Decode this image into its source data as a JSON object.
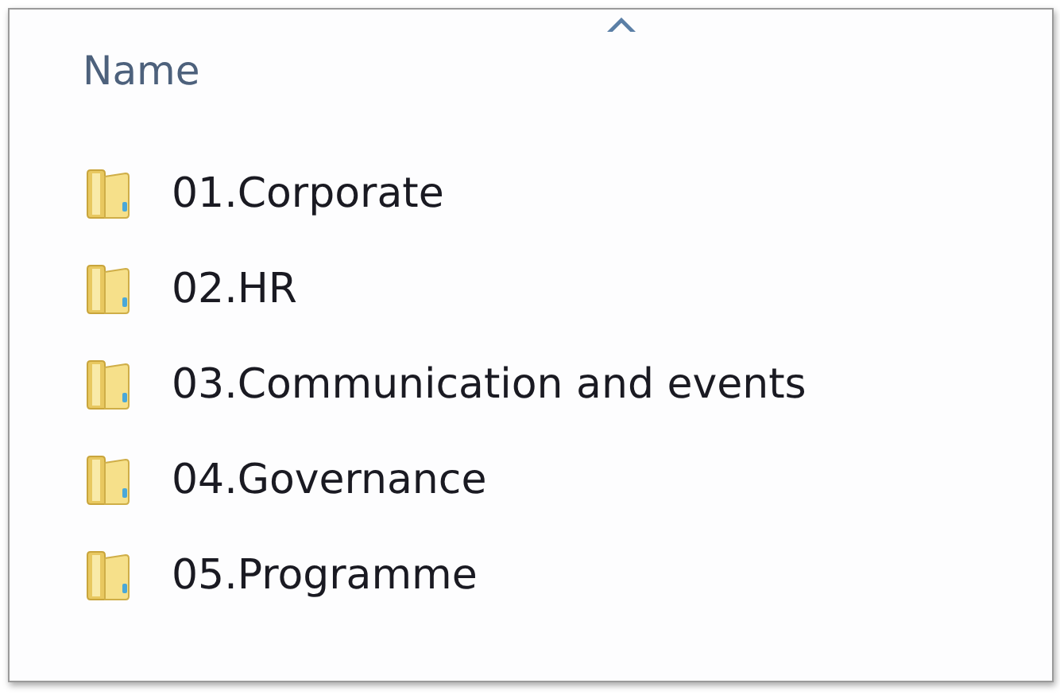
{
  "column": {
    "label": "Name",
    "sorted": true
  },
  "items": [
    {
      "name": "01.Corporate"
    },
    {
      "name": "02.HR"
    },
    {
      "name": "03.Communication and events"
    },
    {
      "name": "04.Governance"
    },
    {
      "name": "05.Programme"
    }
  ]
}
